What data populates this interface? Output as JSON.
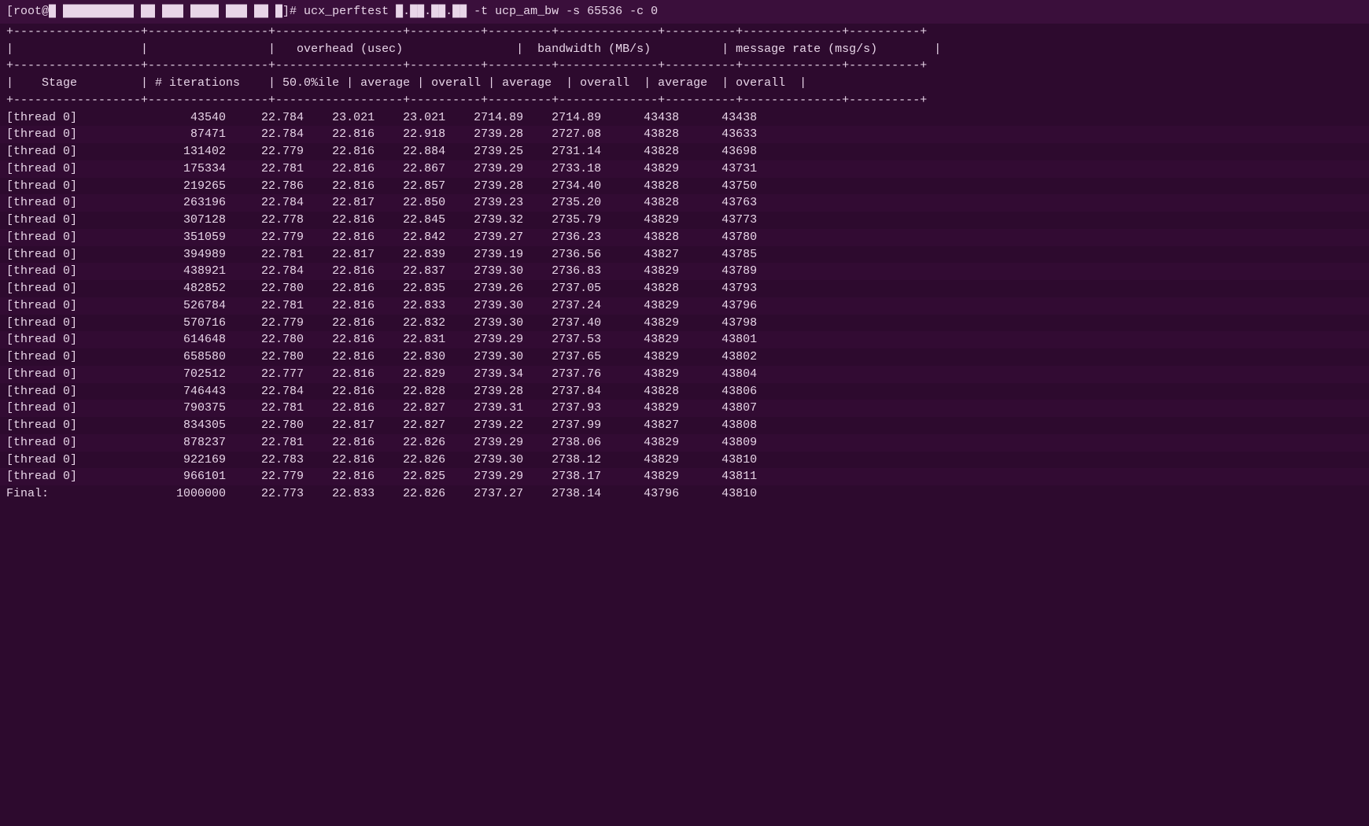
{
  "terminal": {
    "command": "[root@█ ██████████ ██ ███ ████ ███ ██ █]# ucx_perftest █.██.██.██ -t ucp_am_bw -s 65536 -c 0",
    "sep1": "+-----------------+-----------------+------------------+----------+---------+--------------+----------+--------------+----------+",
    "header1": "|                 |                 |   overhead (usec)               |  bandwidth (MB/s)         | message rate (msg/s)       |",
    "sep2": "+-----------------+-----------------+------------------+----------+---------+--------------+----------+--------------+----------+",
    "header2": "|    Stage        | # iterations    | 50.0%ile | average | overall | average  | overall  | average  | overall  |",
    "sep3": "+-----------------+-----------------+------------------+----------+---------+--------------+----------+--------------+----------+",
    "rows": [
      {
        "stage": "[thread 0]",
        "iterations": "43540",
        "p50": "22.784",
        "avg": "23.021",
        "overall_lat": "23.021",
        "bw_avg": "2714.89",
        "bw_overall": "2714.89",
        "mr_avg": "43438",
        "mr_overall": "43438"
      },
      {
        "stage": "[thread 0]",
        "iterations": "87471",
        "p50": "22.784",
        "avg": "22.816",
        "overall_lat": "22.918",
        "bw_avg": "2739.28",
        "bw_overall": "2727.08",
        "mr_avg": "43828",
        "mr_overall": "43633"
      },
      {
        "stage": "[thread 0]",
        "iterations": "131402",
        "p50": "22.779",
        "avg": "22.816",
        "overall_lat": "22.884",
        "bw_avg": "2739.25",
        "bw_overall": "2731.14",
        "mr_avg": "43828",
        "mr_overall": "43698"
      },
      {
        "stage": "[thread 0]",
        "iterations": "175334",
        "p50": "22.781",
        "avg": "22.816",
        "overall_lat": "22.867",
        "bw_avg": "2739.29",
        "bw_overall": "2733.18",
        "mr_avg": "43829",
        "mr_overall": "43731"
      },
      {
        "stage": "[thread 0]",
        "iterations": "219265",
        "p50": "22.786",
        "avg": "22.816",
        "overall_lat": "22.857",
        "bw_avg": "2739.28",
        "bw_overall": "2734.40",
        "mr_avg": "43828",
        "mr_overall": "43750"
      },
      {
        "stage": "[thread 0]",
        "iterations": "263196",
        "p50": "22.784",
        "avg": "22.817",
        "overall_lat": "22.850",
        "bw_avg": "2739.23",
        "bw_overall": "2735.20",
        "mr_avg": "43828",
        "mr_overall": "43763"
      },
      {
        "stage": "[thread 0]",
        "iterations": "307128",
        "p50": "22.778",
        "avg": "22.816",
        "overall_lat": "22.845",
        "bw_avg": "2739.32",
        "bw_overall": "2735.79",
        "mr_avg": "43829",
        "mr_overall": "43773"
      },
      {
        "stage": "[thread 0]",
        "iterations": "351059",
        "p50": "22.779",
        "avg": "22.816",
        "overall_lat": "22.842",
        "bw_avg": "2739.27",
        "bw_overall": "2736.23",
        "mr_avg": "43828",
        "mr_overall": "43780"
      },
      {
        "stage": "[thread 0]",
        "iterations": "394989",
        "p50": "22.781",
        "avg": "22.817",
        "overall_lat": "22.839",
        "bw_avg": "2739.19",
        "bw_overall": "2736.56",
        "mr_avg": "43827",
        "mr_overall": "43785"
      },
      {
        "stage": "[thread 0]",
        "iterations": "438921",
        "p50": "22.784",
        "avg": "22.816",
        "overall_lat": "22.837",
        "bw_avg": "2739.30",
        "bw_overall": "2736.83",
        "mr_avg": "43829",
        "mr_overall": "43789"
      },
      {
        "stage": "[thread 0]",
        "iterations": "482852",
        "p50": "22.780",
        "avg": "22.816",
        "overall_lat": "22.835",
        "bw_avg": "2739.26",
        "bw_overall": "2737.05",
        "mr_avg": "43828",
        "mr_overall": "43793"
      },
      {
        "stage": "[thread 0]",
        "iterations": "526784",
        "p50": "22.781",
        "avg": "22.816",
        "overall_lat": "22.833",
        "bw_avg": "2739.30",
        "bw_overall": "2737.24",
        "mr_avg": "43829",
        "mr_overall": "43796"
      },
      {
        "stage": "[thread 0]",
        "iterations": "570716",
        "p50": "22.779",
        "avg": "22.816",
        "overall_lat": "22.832",
        "bw_avg": "2739.30",
        "bw_overall": "2737.40",
        "mr_avg": "43829",
        "mr_overall": "43798"
      },
      {
        "stage": "[thread 0]",
        "iterations": "614648",
        "p50": "22.780",
        "avg": "22.816",
        "overall_lat": "22.831",
        "bw_avg": "2739.29",
        "bw_overall": "2737.53",
        "mr_avg": "43829",
        "mr_overall": "43801"
      },
      {
        "stage": "[thread 0]",
        "iterations": "658580",
        "p50": "22.780",
        "avg": "22.816",
        "overall_lat": "22.830",
        "bw_avg": "2739.30",
        "bw_overall": "2737.65",
        "mr_avg": "43829",
        "mr_overall": "43802"
      },
      {
        "stage": "[thread 0]",
        "iterations": "702512",
        "p50": "22.777",
        "avg": "22.816",
        "overall_lat": "22.829",
        "bw_avg": "2739.34",
        "bw_overall": "2737.76",
        "mr_avg": "43829",
        "mr_overall": "43804"
      },
      {
        "stage": "[thread 0]",
        "iterations": "746443",
        "p50": "22.784",
        "avg": "22.816",
        "overall_lat": "22.828",
        "bw_avg": "2739.28",
        "bw_overall": "2737.84",
        "mr_avg": "43828",
        "mr_overall": "43806"
      },
      {
        "stage": "[thread 0]",
        "iterations": "790375",
        "p50": "22.781",
        "avg": "22.816",
        "overall_lat": "22.827",
        "bw_avg": "2739.31",
        "bw_overall": "2737.93",
        "mr_avg": "43829",
        "mr_overall": "43807"
      },
      {
        "stage": "[thread 0]",
        "iterations": "834305",
        "p50": "22.780",
        "avg": "22.817",
        "overall_lat": "22.827",
        "bw_avg": "2739.22",
        "bw_overall": "2737.99",
        "mr_avg": "43827",
        "mr_overall": "43808"
      },
      {
        "stage": "[thread 0]",
        "iterations": "878237",
        "p50": "22.781",
        "avg": "22.816",
        "overall_lat": "22.826",
        "bw_avg": "2739.29",
        "bw_overall": "2738.06",
        "mr_avg": "43829",
        "mr_overall": "43809"
      },
      {
        "stage": "[thread 0]",
        "iterations": "922169",
        "p50": "22.783",
        "avg": "22.816",
        "overall_lat": "22.826",
        "bw_avg": "2739.30",
        "bw_overall": "2738.12",
        "mr_avg": "43829",
        "mr_overall": "43810"
      },
      {
        "stage": "[thread 0]",
        "iterations": "966101",
        "p50": "22.779",
        "avg": "22.816",
        "overall_lat": "22.825",
        "bw_avg": "2739.29",
        "bw_overall": "2738.17",
        "mr_avg": "43829",
        "mr_overall": "43811"
      }
    ],
    "final": {
      "stage": "Final:",
      "iterations": "1000000",
      "p50": "22.773",
      "avg": "22.833",
      "overall_lat": "22.826",
      "bw_avg": "2737.27",
      "bw_overall": "2738.14",
      "mr_avg": "43796",
      "mr_overall": "43810"
    }
  }
}
